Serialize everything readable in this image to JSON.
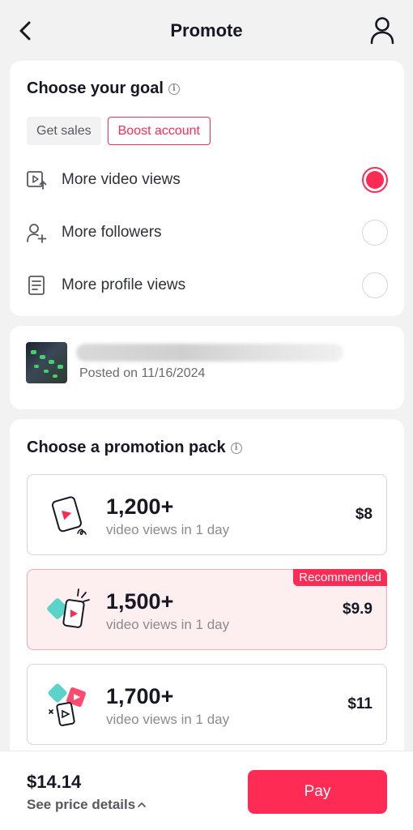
{
  "header": {
    "title": "Promote"
  },
  "goal": {
    "title": "Choose your goal",
    "tabs": [
      {
        "label": "Get sales",
        "active": false
      },
      {
        "label": "Boost account",
        "active": true
      }
    ],
    "options": [
      {
        "label": "More video views",
        "icon": "video-views-icon",
        "selected": true
      },
      {
        "label": "More followers",
        "icon": "add-follower-icon",
        "selected": false
      },
      {
        "label": "More profile views",
        "icon": "profile-doc-icon",
        "selected": false
      }
    ]
  },
  "post": {
    "posted_text": "Posted on 11/16/2024"
  },
  "packs": {
    "title": "Choose a promotion pack",
    "items": [
      {
        "views": "1,200+",
        "desc": "video views in 1 day",
        "price": "$8",
        "selected": false
      },
      {
        "views": "1,500+",
        "desc": "video views in 1 day",
        "price": "$9.9",
        "selected": true,
        "badge": "Recommended"
      },
      {
        "views": "1,700+",
        "desc": "video views in 1 day",
        "price": "$11",
        "selected": false
      }
    ]
  },
  "footer": {
    "total": "$14.14",
    "details": "See price details",
    "pay": "Pay"
  },
  "colors": {
    "accent": "#fe2c55",
    "teal": "#5ad3c9",
    "selected_bg": "#fdeef0"
  }
}
